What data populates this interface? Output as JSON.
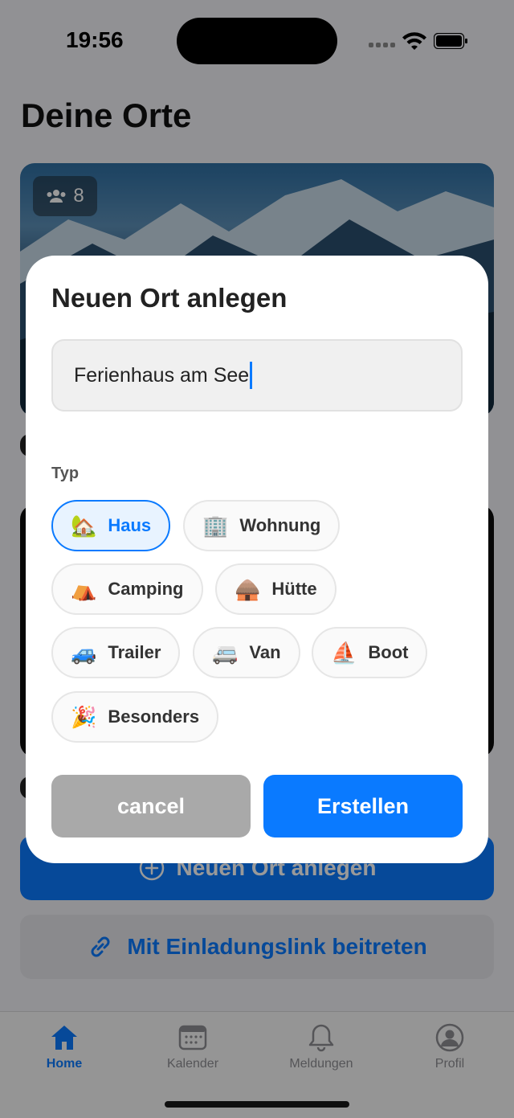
{
  "status_bar": {
    "time": "19:56"
  },
  "page": {
    "title": "Deine Orte"
  },
  "place_card": {
    "member_count": "8"
  },
  "actions": {
    "new_place_label": "Neuen Ort anlegen",
    "join_label": "Mit Einladungslink beitreten"
  },
  "tabbar": {
    "items": [
      {
        "label": "Home",
        "icon": "house-icon",
        "active": true
      },
      {
        "label": "Kalender",
        "icon": "calendar-icon",
        "active": false
      },
      {
        "label": "Meldungen",
        "icon": "bell-icon",
        "active": false
      },
      {
        "label": "Profil",
        "icon": "person-circle-icon",
        "active": false
      }
    ]
  },
  "modal": {
    "title": "Neuen Ort anlegen",
    "name_value": "Ferienhaus am See",
    "type_label": "Typ",
    "types": [
      {
        "emoji": "🏡",
        "label": "Haus",
        "selected": true
      },
      {
        "emoji": "🏢",
        "label": "Wohnung",
        "selected": false
      },
      {
        "emoji": "⛺",
        "label": "Camping",
        "selected": false
      },
      {
        "emoji": "🛖",
        "label": "Hütte",
        "selected": false
      },
      {
        "emoji": "🚙",
        "label": "Trailer",
        "selected": false
      },
      {
        "emoji": "🚐",
        "label": "Van",
        "selected": false
      },
      {
        "emoji": "⛵",
        "label": "Boot",
        "selected": false
      },
      {
        "emoji": "🎉",
        "label": "Besonders",
        "selected": false
      }
    ],
    "cancel_label": "cancel",
    "create_label": "Erstellen"
  },
  "colors": {
    "accent": "#0a7aff",
    "cancel": "#a9a9a9"
  }
}
